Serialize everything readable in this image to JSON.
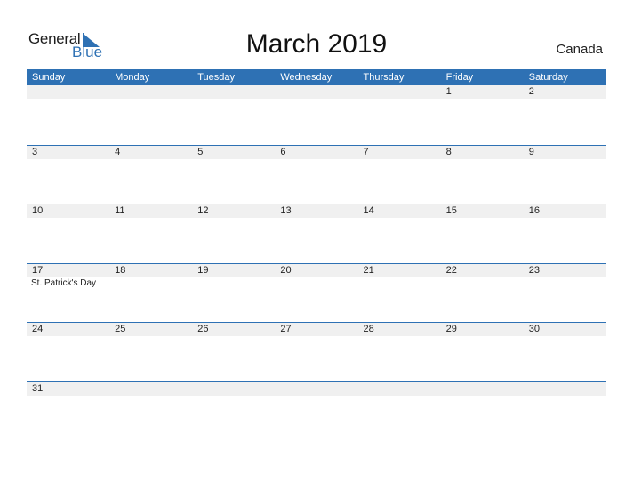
{
  "logo": {
    "general": "General",
    "blue": "Blue",
    "icon": "triangle-flag-icon"
  },
  "title": "March 2019",
  "country": "Canada",
  "weekdays": [
    "Sunday",
    "Monday",
    "Tuesday",
    "Wednesday",
    "Thursday",
    "Friday",
    "Saturday"
  ],
  "weeks": [
    {
      "days": [
        "",
        "",
        "",
        "",
        "",
        "1",
        "2"
      ],
      "events": [
        "",
        "",
        "",
        "",
        "",
        "",
        ""
      ]
    },
    {
      "days": [
        "3",
        "4",
        "5",
        "6",
        "7",
        "8",
        "9"
      ],
      "events": [
        "",
        "",
        "",
        "",
        "",
        "",
        ""
      ]
    },
    {
      "days": [
        "10",
        "11",
        "12",
        "13",
        "14",
        "15",
        "16"
      ],
      "events": [
        "",
        "",
        "",
        "",
        "",
        "",
        ""
      ]
    },
    {
      "days": [
        "17",
        "18",
        "19",
        "20",
        "21",
        "22",
        "23"
      ],
      "events": [
        "St. Patrick's Day",
        "",
        "",
        "",
        "",
        "",
        ""
      ]
    },
    {
      "days": [
        "24",
        "25",
        "26",
        "27",
        "28",
        "29",
        "30"
      ],
      "events": [
        "",
        "",
        "",
        "",
        "",
        "",
        ""
      ]
    },
    {
      "days": [
        "31",
        "",
        "",
        "",
        "",
        "",
        ""
      ],
      "events": [
        "",
        "",
        "",
        "",
        "",
        "",
        ""
      ]
    }
  ],
  "colors": {
    "accent": "#2e71b4",
    "date_strip": "#f0f0f0"
  }
}
